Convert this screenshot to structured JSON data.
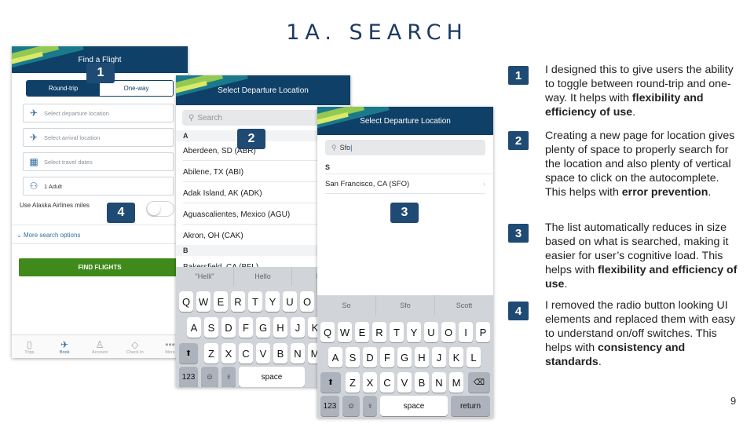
{
  "slide": {
    "title": "1A. SEARCH",
    "page_number": "9"
  },
  "screen1": {
    "header_title": "Find a Flight",
    "toggle": {
      "round_trip": "Round-trip",
      "one_way": "One-way",
      "selected": "Round-trip"
    },
    "fields": {
      "departure": "Select departure location",
      "arrival": "Select arrival location",
      "dates": "Select travel dates",
      "travelers": "1 Adult"
    },
    "miles_label": "Use Alaska Airlines miles",
    "miles_switch_on": false,
    "more_options": "More search options",
    "find_button": "FIND FLIGHTS",
    "tabs": [
      {
        "label": "Trips",
        "icon": "trips-icon",
        "active": false
      },
      {
        "label": "Book",
        "icon": "plane-icon",
        "active": true
      },
      {
        "label": "Account",
        "icon": "account-icon",
        "active": false
      },
      {
        "label": "Check In",
        "icon": "checkin-icon",
        "active": false
      },
      {
        "label": "More",
        "icon": "more-icon",
        "active": false
      }
    ]
  },
  "screen2": {
    "header_title": "Select Departure Location",
    "search_placeholder": "Search",
    "section_a": "A",
    "rows": [
      "Aberdeen, SD (ABR)",
      "Abilene, TX (ABI)",
      "Adak Island, AK (ADK)",
      "Aguascalientes, Mexico (AGU)",
      "Akron, OH (CAK)"
    ],
    "section_b": "B",
    "partial_row": "Bakersfield, CA (BFL)",
    "suggestions": [
      "\"Helli\"",
      "Hello",
      "He"
    ],
    "keys_row1": [
      "Q",
      "W",
      "E",
      "R",
      "T",
      "Y",
      "U",
      "O"
    ],
    "keys_row2": [
      "A",
      "S",
      "D",
      "F",
      "G",
      "H",
      "J",
      "K"
    ],
    "keys_row3": [
      "Z",
      "X",
      "C",
      "V",
      "B",
      "N",
      "M"
    ],
    "key_123": "123",
    "key_space": "space"
  },
  "screen3": {
    "header_title": "Select Departure Location",
    "search_value": "Sfo",
    "section": "S",
    "result": "San Francisco, CA (SFO)",
    "suggestions": [
      "So",
      "Sfo",
      "Scott"
    ],
    "keys_row1": [
      "Q",
      "W",
      "E",
      "R",
      "T",
      "Y",
      "U",
      "O",
      "I",
      "P"
    ],
    "keys_row2": [
      "A",
      "S",
      "D",
      "F",
      "G",
      "H",
      "J",
      "K",
      "L"
    ],
    "keys_row3": [
      "Z",
      "X",
      "C",
      "V",
      "B",
      "N",
      "M"
    ],
    "key_123": "123",
    "key_space": "space",
    "key_return": "return"
  },
  "badges": [
    "1",
    "2",
    "3",
    "4"
  ],
  "notes": [
    {
      "num": "1",
      "text": "I designed this to give users the ability to toggle between round-trip and one-way. It helps with ",
      "bold": "flexibility and efficiency of use",
      "end": "."
    },
    {
      "num": "2",
      "text": "Creating a new page for location gives plenty of space to properly search for the location and also plenty of vertical space to click on the autocomplete. This helps with ",
      "bold": "error prevention",
      "end": "."
    },
    {
      "num": "3",
      "text": "The list automatically reduces in size based on what is searched, making it easier for user’s cognitive load. This helps with ",
      "bold": "flexibility and efficiency of use",
      "end": "."
    },
    {
      "num": "4",
      "text": "I removed the radio button looking UI elements and replaced them with easy to understand on/off switches. This helps with ",
      "bold": "consistency and standards",
      "end": "."
    }
  ],
  "colors": {
    "navy": "#0f4068",
    "badge": "#1f4a73",
    "green": "#3f8a1b",
    "link": "#2f6da3"
  }
}
